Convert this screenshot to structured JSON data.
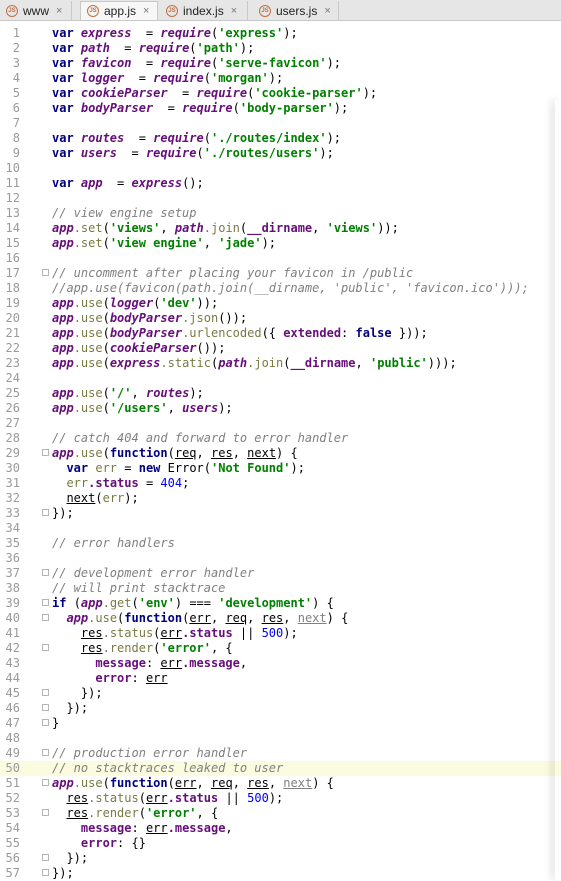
{
  "tabs": [
    {
      "label": "www",
      "icon": "js-file-icon",
      "active": false
    },
    {
      "label": "app.js",
      "icon": "js-file-icon",
      "active": true
    },
    {
      "label": "index.js",
      "icon": "js-file-icon",
      "active": false
    },
    {
      "label": "users.js",
      "icon": "js-file-icon",
      "active": false
    }
  ],
  "tab_close_glyph": "×",
  "js_icon_text": "JS",
  "current_line": 50,
  "lines": [
    {
      "n": "1",
      "fold": false,
      "segs": [
        [
          "kw",
          "var "
        ],
        [
          "fld",
          "express"
        ],
        [
          "",
          "  = "
        ],
        [
          "fld",
          "require"
        ],
        [
          "",
          "("
        ],
        [
          "str",
          "'express'"
        ],
        [
          "",
          ");"
        ]
      ]
    },
    {
      "n": "2",
      "fold": false,
      "segs": [
        [
          "kw",
          "var "
        ],
        [
          "fld",
          "path"
        ],
        [
          "",
          "  = "
        ],
        [
          "fld",
          "require"
        ],
        [
          "",
          "("
        ],
        [
          "str",
          "'path'"
        ],
        [
          "",
          ");"
        ]
      ]
    },
    {
      "n": "3",
      "fold": false,
      "segs": [
        [
          "kw",
          "var "
        ],
        [
          "fld",
          "favicon"
        ],
        [
          "",
          "  = "
        ],
        [
          "fld",
          "require"
        ],
        [
          "",
          "("
        ],
        [
          "str",
          "'serve-favicon'"
        ],
        [
          "",
          ");"
        ]
      ]
    },
    {
      "n": "4",
      "fold": false,
      "segs": [
        [
          "kw",
          "var "
        ],
        [
          "fld",
          "logger"
        ],
        [
          "",
          "  = "
        ],
        [
          "fld",
          "require"
        ],
        [
          "",
          "("
        ],
        [
          "str",
          "'morgan'"
        ],
        [
          "",
          ");"
        ]
      ]
    },
    {
      "n": "5",
      "fold": false,
      "segs": [
        [
          "kw",
          "var "
        ],
        [
          "fld",
          "cookieParser"
        ],
        [
          "",
          "  = "
        ],
        [
          "fld",
          "require"
        ],
        [
          "",
          "("
        ],
        [
          "str",
          "'cookie-parser'"
        ],
        [
          "",
          ");"
        ]
      ]
    },
    {
      "n": "6",
      "fold": false,
      "segs": [
        [
          "kw",
          "var "
        ],
        [
          "fld",
          "bodyParser"
        ],
        [
          "",
          "  = "
        ],
        [
          "fld",
          "require"
        ],
        [
          "",
          "("
        ],
        [
          "str",
          "'body-parser'"
        ],
        [
          "",
          ");"
        ]
      ]
    },
    {
      "n": "7",
      "fold": false,
      "segs": []
    },
    {
      "n": "8",
      "fold": false,
      "segs": [
        [
          "kw",
          "var "
        ],
        [
          "fld",
          "routes"
        ],
        [
          "",
          "  = "
        ],
        [
          "fld",
          "require"
        ],
        [
          "",
          "("
        ],
        [
          "str",
          "'./routes/index'"
        ],
        [
          "",
          ");"
        ]
      ]
    },
    {
      "n": "9",
      "fold": false,
      "segs": [
        [
          "kw",
          "var "
        ],
        [
          "fld",
          "users"
        ],
        [
          "",
          "  = "
        ],
        [
          "fld",
          "require"
        ],
        [
          "",
          "("
        ],
        [
          "str",
          "'./routes/users'"
        ],
        [
          "",
          ");"
        ]
      ]
    },
    {
      "n": "10",
      "fold": false,
      "segs": []
    },
    {
      "n": "11",
      "fold": false,
      "segs": [
        [
          "kw",
          "var "
        ],
        [
          "fld",
          "app"
        ],
        [
          "",
          "  = "
        ],
        [
          "fld",
          "express"
        ],
        [
          "",
          "();"
        ]
      ]
    },
    {
      "n": "12",
      "fold": false,
      "segs": []
    },
    {
      "n": "13",
      "fold": false,
      "segs": [
        [
          "cmt",
          "// view engine setup"
        ]
      ]
    },
    {
      "n": "14",
      "fold": false,
      "segs": [
        [
          "fld",
          "app"
        ],
        [
          "method",
          ".set"
        ],
        [
          "",
          "("
        ],
        [
          "str",
          "'views'"
        ],
        [
          "",
          ", "
        ],
        [
          "fld",
          "path"
        ],
        [
          "method",
          ".join"
        ],
        [
          "",
          "("
        ],
        [
          "prop",
          "__dirname"
        ],
        [
          "",
          ", "
        ],
        [
          "str",
          "'views'"
        ],
        [
          "",
          "));"
        ]
      ]
    },
    {
      "n": "15",
      "fold": false,
      "segs": [
        [
          "fld",
          "app"
        ],
        [
          "method",
          ".set"
        ],
        [
          "",
          "("
        ],
        [
          "str",
          "'view engine'"
        ],
        [
          "",
          ", "
        ],
        [
          "str",
          "'jade'"
        ],
        [
          "",
          ");"
        ]
      ]
    },
    {
      "n": "16",
      "fold": false,
      "segs": []
    },
    {
      "n": "17",
      "fold": true,
      "segs": [
        [
          "cmt",
          "// uncomment after placing your favicon in /public"
        ]
      ]
    },
    {
      "n": "18",
      "fold": false,
      "segs": [
        [
          "cmt",
          "//app.use(favicon(path.join(__dirname, 'public', 'favicon.ico')));"
        ]
      ]
    },
    {
      "n": "19",
      "fold": false,
      "segs": [
        [
          "fld",
          "app"
        ],
        [
          "method",
          ".use"
        ],
        [
          "",
          "("
        ],
        [
          "fld",
          "logger"
        ],
        [
          "",
          "("
        ],
        [
          "str",
          "'dev'"
        ],
        [
          "",
          "));"
        ]
      ]
    },
    {
      "n": "20",
      "fold": false,
      "segs": [
        [
          "fld",
          "app"
        ],
        [
          "method",
          ".use"
        ],
        [
          "",
          "("
        ],
        [
          "fld",
          "bodyParser"
        ],
        [
          "method",
          ".json"
        ],
        [
          "",
          "());"
        ]
      ]
    },
    {
      "n": "21",
      "fold": false,
      "segs": [
        [
          "fld",
          "app"
        ],
        [
          "method",
          ".use"
        ],
        [
          "",
          "("
        ],
        [
          "fld",
          "bodyParser"
        ],
        [
          "method",
          ".urlencoded"
        ],
        [
          "",
          "({ "
        ],
        [
          "prop",
          "extended"
        ],
        [
          "",
          ": "
        ],
        [
          "kw",
          "false"
        ],
        [
          "",
          " }));"
        ]
      ]
    },
    {
      "n": "22",
      "fold": false,
      "segs": [
        [
          "fld",
          "app"
        ],
        [
          "method",
          ".use"
        ],
        [
          "",
          "("
        ],
        [
          "fld",
          "cookieParser"
        ],
        [
          "",
          "());"
        ]
      ]
    },
    {
      "n": "23",
      "fold": false,
      "segs": [
        [
          "fld",
          "app"
        ],
        [
          "method",
          ".use"
        ],
        [
          "",
          "("
        ],
        [
          "fld",
          "express"
        ],
        [
          "method",
          ".static"
        ],
        [
          "",
          "("
        ],
        [
          "fld",
          "path"
        ],
        [
          "method",
          ".join"
        ],
        [
          "",
          "("
        ],
        [
          "prop",
          "__dirname"
        ],
        [
          "",
          ", "
        ],
        [
          "str",
          "'public'"
        ],
        [
          "",
          ")));"
        ]
      ]
    },
    {
      "n": "24",
      "fold": false,
      "segs": []
    },
    {
      "n": "25",
      "fold": false,
      "segs": [
        [
          "fld",
          "app"
        ],
        [
          "method",
          ".use"
        ],
        [
          "",
          "("
        ],
        [
          "str",
          "'/'"
        ],
        [
          "",
          ", "
        ],
        [
          "fld",
          "routes"
        ],
        [
          "",
          ");"
        ]
      ]
    },
    {
      "n": "26",
      "fold": false,
      "segs": [
        [
          "fld",
          "app"
        ],
        [
          "method",
          ".use"
        ],
        [
          "",
          "("
        ],
        [
          "str",
          "'/users'"
        ],
        [
          "",
          ", "
        ],
        [
          "fld",
          "users"
        ],
        [
          "",
          ");"
        ]
      ]
    },
    {
      "n": "27",
      "fold": false,
      "segs": []
    },
    {
      "n": "28",
      "fold": false,
      "segs": [
        [
          "cmt",
          "// catch 404 and forward to error handler"
        ]
      ]
    },
    {
      "n": "29",
      "fold": true,
      "segs": [
        [
          "fld",
          "app"
        ],
        [
          "method",
          ".use"
        ],
        [
          "",
          "("
        ],
        [
          "kw",
          "function"
        ],
        [
          "",
          "("
        ],
        [
          "param",
          "req"
        ],
        [
          "",
          ", "
        ],
        [
          "param",
          "res"
        ],
        [
          "",
          ", "
        ],
        [
          "param",
          "next"
        ],
        [
          "",
          ") {"
        ]
      ]
    },
    {
      "n": "30",
      "fold": false,
      "segs": [
        [
          "",
          "  "
        ],
        [
          "kw",
          "var "
        ],
        [
          "method",
          "err"
        ],
        [
          "",
          " = "
        ],
        [
          "kw",
          "new "
        ],
        [
          "",
          "Error("
        ],
        [
          "str",
          "'Not Found'"
        ],
        [
          "",
          ");"
        ]
      ]
    },
    {
      "n": "31",
      "fold": false,
      "segs": [
        [
          "",
          "  "
        ],
        [
          "method",
          "err"
        ],
        [
          "prop",
          ".status"
        ],
        [
          "",
          " = "
        ],
        [
          "num",
          "404"
        ],
        [
          "",
          ";"
        ]
      ]
    },
    {
      "n": "32",
      "fold": false,
      "segs": [
        [
          "",
          "  "
        ],
        [
          "param",
          "next"
        ],
        [
          "",
          "("
        ],
        [
          "method",
          "err"
        ],
        [
          "",
          ");"
        ]
      ]
    },
    {
      "n": "33",
      "fold": true,
      "segs": [
        [
          "",
          "});"
        ]
      ]
    },
    {
      "n": "34",
      "fold": false,
      "segs": []
    },
    {
      "n": "35",
      "fold": false,
      "segs": [
        [
          "cmt",
          "// error handlers"
        ]
      ]
    },
    {
      "n": "36",
      "fold": false,
      "segs": []
    },
    {
      "n": "37",
      "fold": true,
      "segs": [
        [
          "cmt",
          "// development error handler"
        ]
      ]
    },
    {
      "n": "38",
      "fold": false,
      "segs": [
        [
          "cmt",
          "// will print stacktrace"
        ]
      ]
    },
    {
      "n": "39",
      "fold": true,
      "segs": [
        [
          "kw",
          "if "
        ],
        [
          "",
          "("
        ],
        [
          "fld",
          "app"
        ],
        [
          "method",
          ".get"
        ],
        [
          "",
          "("
        ],
        [
          "str",
          "'env'"
        ],
        [
          "",
          ") === "
        ],
        [
          "str",
          "'development'"
        ],
        [
          "",
          ") {"
        ]
      ]
    },
    {
      "n": "40",
      "fold": true,
      "segs": [
        [
          "",
          "  "
        ],
        [
          "fld",
          "app"
        ],
        [
          "method",
          ".use"
        ],
        [
          "",
          "("
        ],
        [
          "kw",
          "function"
        ],
        [
          "",
          "("
        ],
        [
          "param",
          "err"
        ],
        [
          "",
          ", "
        ],
        [
          "param",
          "req"
        ],
        [
          "",
          ", "
        ],
        [
          "param",
          "res"
        ],
        [
          "",
          ", "
        ],
        [
          "unused",
          "next"
        ],
        [
          "",
          ") {"
        ]
      ]
    },
    {
      "n": "41",
      "fold": false,
      "segs": [
        [
          "",
          "    "
        ],
        [
          "param",
          "res"
        ],
        [
          "method",
          ".status"
        ],
        [
          "",
          "("
        ],
        [
          "param",
          "err"
        ],
        [
          "prop",
          ".status"
        ],
        [
          "",
          " || "
        ],
        [
          "num",
          "500"
        ],
        [
          "",
          ");"
        ]
      ]
    },
    {
      "n": "42",
      "fold": true,
      "segs": [
        [
          "",
          "    "
        ],
        [
          "param",
          "res"
        ],
        [
          "method",
          ".render"
        ],
        [
          "",
          "("
        ],
        [
          "str",
          "'error'"
        ],
        [
          "",
          ", {"
        ]
      ]
    },
    {
      "n": "43",
      "fold": false,
      "segs": [
        [
          "",
          "      "
        ],
        [
          "prop",
          "message"
        ],
        [
          "",
          ": "
        ],
        [
          "param",
          "err"
        ],
        [
          "prop",
          ".message"
        ],
        [
          "",
          ","
        ]
      ]
    },
    {
      "n": "44",
      "fold": false,
      "segs": [
        [
          "",
          "      "
        ],
        [
          "prop",
          "error"
        ],
        [
          "",
          ": "
        ],
        [
          "param",
          "err"
        ]
      ]
    },
    {
      "n": "45",
      "fold": true,
      "segs": [
        [
          "",
          "    });"
        ]
      ]
    },
    {
      "n": "46",
      "fold": true,
      "segs": [
        [
          "",
          "  });"
        ]
      ]
    },
    {
      "n": "47",
      "fold": true,
      "segs": [
        [
          "",
          "}"
        ]
      ]
    },
    {
      "n": "48",
      "fold": false,
      "segs": []
    },
    {
      "n": "49",
      "fold": true,
      "segs": [
        [
          "cmt",
          "// production error handler"
        ]
      ]
    },
    {
      "n": "50",
      "fold": false,
      "segs": [
        [
          "cmt",
          "// no stacktraces leaked to user"
        ]
      ]
    },
    {
      "n": "51",
      "fold": true,
      "segs": [
        [
          "fld",
          "app"
        ],
        [
          "method",
          ".use"
        ],
        [
          "",
          "("
        ],
        [
          "kw",
          "function"
        ],
        [
          "",
          "("
        ],
        [
          "param",
          "err"
        ],
        [
          "",
          ", "
        ],
        [
          "param",
          "req"
        ],
        [
          "",
          ", "
        ],
        [
          "param",
          "res"
        ],
        [
          "",
          ", "
        ],
        [
          "unused",
          "next"
        ],
        [
          "",
          ") {"
        ]
      ]
    },
    {
      "n": "52",
      "fold": false,
      "segs": [
        [
          "",
          "  "
        ],
        [
          "param",
          "res"
        ],
        [
          "method",
          ".status"
        ],
        [
          "",
          "("
        ],
        [
          "param",
          "err"
        ],
        [
          "prop",
          ".status"
        ],
        [
          "",
          " || "
        ],
        [
          "num",
          "500"
        ],
        [
          "",
          ");"
        ]
      ]
    },
    {
      "n": "53",
      "fold": true,
      "segs": [
        [
          "",
          "  "
        ],
        [
          "param",
          "res"
        ],
        [
          "method",
          ".render"
        ],
        [
          "",
          "("
        ],
        [
          "str",
          "'error'"
        ],
        [
          "",
          ", {"
        ]
      ]
    },
    {
      "n": "54",
      "fold": false,
      "segs": [
        [
          "",
          "    "
        ],
        [
          "prop",
          "message"
        ],
        [
          "",
          ": "
        ],
        [
          "param",
          "err"
        ],
        [
          "prop",
          ".message"
        ],
        [
          "",
          ","
        ]
      ]
    },
    {
      "n": "55",
      "fold": false,
      "segs": [
        [
          "",
          "    "
        ],
        [
          "prop",
          "error"
        ],
        [
          "",
          ": {}"
        ]
      ]
    },
    {
      "n": "56",
      "fold": true,
      "segs": [
        [
          "",
          "  });"
        ]
      ]
    },
    {
      "n": "57",
      "fold": true,
      "segs": [
        [
          "",
          "});"
        ]
      ]
    }
  ]
}
